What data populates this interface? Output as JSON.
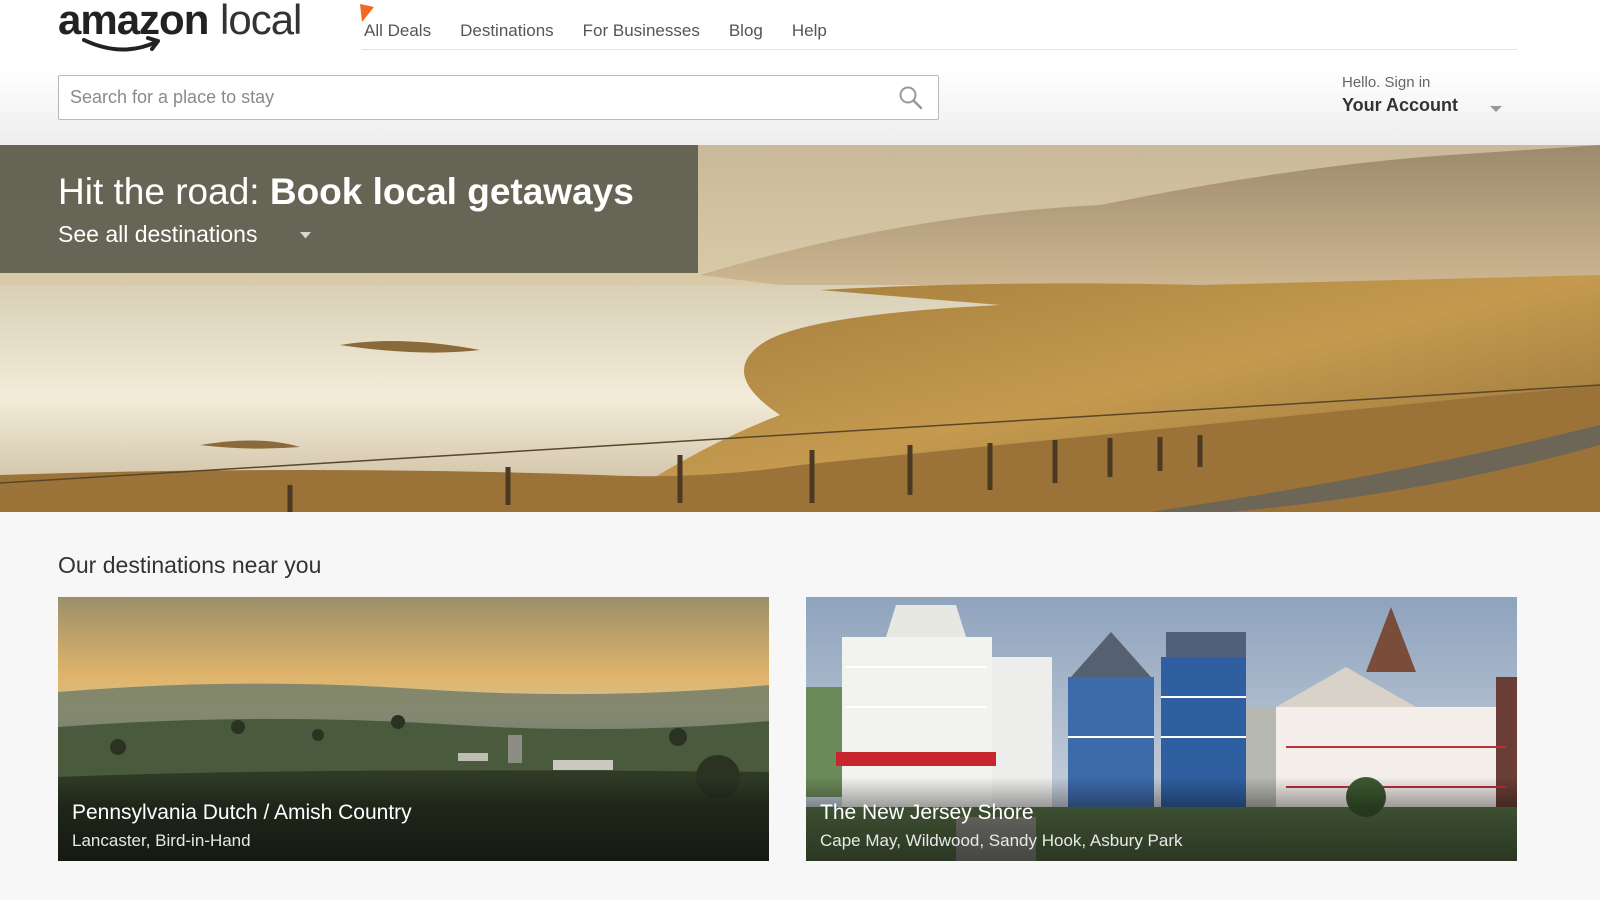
{
  "brand": {
    "word1": "amazon",
    "word2": "local",
    "accent_color": "#f26722"
  },
  "nav": {
    "items": [
      {
        "label": "All Deals"
      },
      {
        "label": "Destinations"
      },
      {
        "label": "For Businesses"
      },
      {
        "label": "Blog"
      },
      {
        "label": "Help"
      }
    ]
  },
  "search": {
    "placeholder": "Search for a place to stay",
    "icon": "search-icon"
  },
  "account": {
    "greeting": "Hello. Sign in",
    "label": "Your Account",
    "icon": "chevron-down-icon"
  },
  "hero": {
    "title_prefix": "Hit the road: ",
    "title_bold": "Book local getaways",
    "link": "See all destinations",
    "link_icon": "chevron-down-icon"
  },
  "destinations": {
    "heading": "Our destinations near you",
    "cards": [
      {
        "title": "Pennsylvania Dutch / Amish Country",
        "subtitle": "Lancaster, Bird-in-Hand"
      },
      {
        "title": "The New Jersey Shore",
        "subtitle": "Cape May, Wildwood, Sandy Hook, Asbury Park"
      }
    ]
  }
}
